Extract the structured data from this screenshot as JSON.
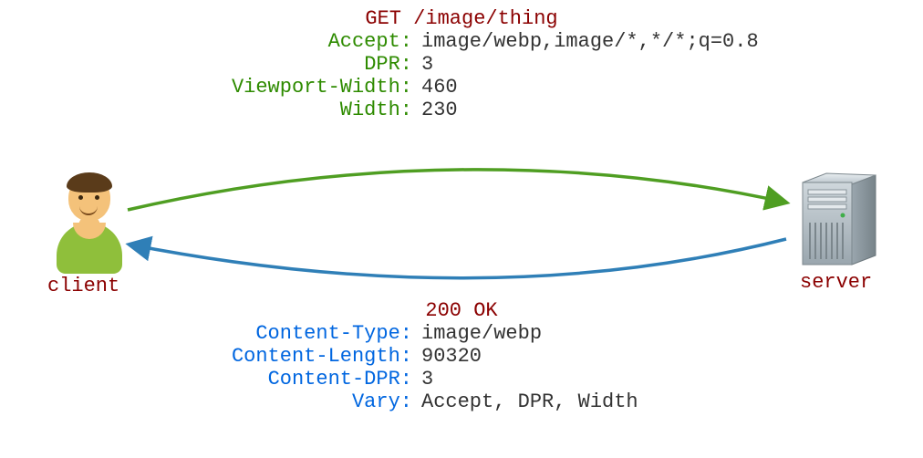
{
  "client_label": "client",
  "server_label": "server",
  "request": {
    "line": "GET /image/thing",
    "headers": [
      {
        "key": "Accept:",
        "value": "image/webp,image/*,*/*;q=0.8"
      },
      {
        "key": "DPR:",
        "value": "3"
      },
      {
        "key": "Viewport-Width:",
        "value": "460"
      },
      {
        "key": "Width:",
        "value": "230"
      }
    ]
  },
  "response": {
    "status": "200 OK",
    "headers": [
      {
        "key": "Content-Type:",
        "value": "image/webp"
      },
      {
        "key": "Content-Length:",
        "value": "90320"
      },
      {
        "key": "Content-DPR:",
        "value": "3"
      },
      {
        "key": "Vary:",
        "value": "Accept, DPR, Width"
      }
    ]
  },
  "colors": {
    "request_header_key": "#2e8b00",
    "response_header_key": "#0066e0",
    "emphasis": "#8b0000",
    "request_arrow": "#4f9e22",
    "response_arrow": "#2f7fb7"
  }
}
